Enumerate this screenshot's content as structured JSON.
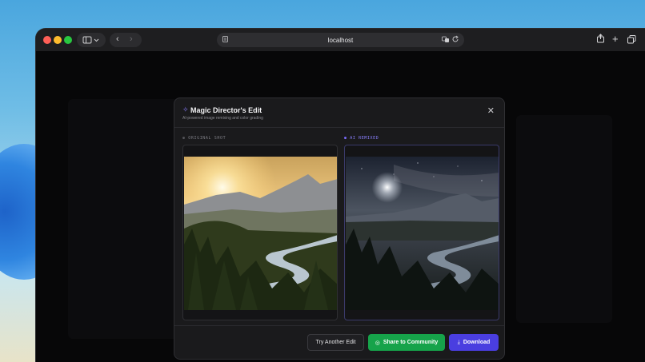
{
  "browser": {
    "address": "localhost",
    "colors": {
      "red": "#ff5f57",
      "yellow": "#febc2e",
      "green": "#28c840"
    }
  },
  "modal": {
    "title": "Magic Director's Edit",
    "subtitle": "AI-powered image remixing and color grading",
    "original_label": "ORIGINAL SHOT",
    "remixed_label": "AI REMIXED",
    "buttons": {
      "try_another": "Try Another Edit",
      "share": "Share to Community",
      "download": "Download"
    },
    "colors": {
      "accent": "#4a3ee0",
      "share": "#16a34a",
      "remix_dot": "#7c6cff"
    }
  }
}
